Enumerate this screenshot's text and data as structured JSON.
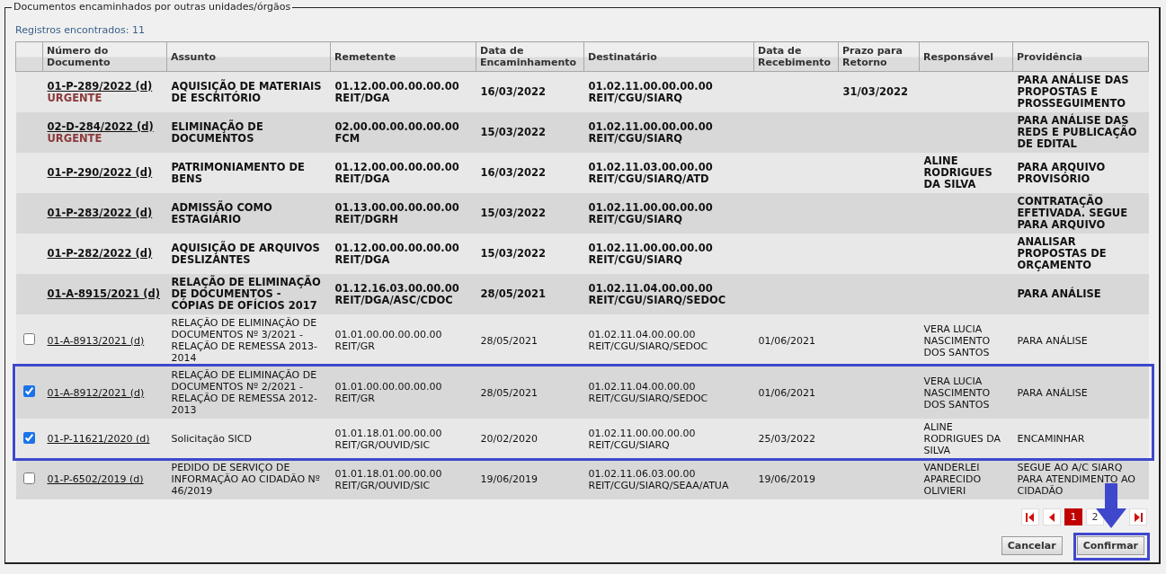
{
  "fieldset": {
    "legend": "Documentos encaminhados por outras unidades/órgãos",
    "count_label": "Registros encontrados: 11"
  },
  "table": {
    "columns": [
      "Número do Documento",
      "Assunto",
      "Remetente",
      "Data de Encaminhamento",
      "Destinatário",
      "Data de Recebimento",
      "Prazo para Retorno",
      "Responsável",
      "Providência"
    ],
    "rows": [
      {
        "kind": "pending",
        "highlighted": false,
        "urgent": "URGENTE",
        "cells": [
          "01-P-289/2022 (d)",
          "AQUISIÇÃO DE MATERIAIS DE ESCRITÓRIO",
          "01.12.00.00.00.00.00 REIT/DGA",
          "16/03/2022",
          "01.02.11.00.00.00.00 REIT/CGU/SIARQ",
          "",
          "31/03/2022",
          "",
          "PARA ANÁLISE DAS PROPOSTAS E PROSSEGUIMENTO"
        ]
      },
      {
        "kind": "pending",
        "highlighted": false,
        "urgent": "URGENTE",
        "cells": [
          "02-D-284/2022 (d)",
          "ELIMINAÇÃO DE DOCUMENTOS",
          "02.00.00.00.00.00.00 FCM",
          "15/03/2022",
          "01.02.11.00.00.00.00 REIT/CGU/SIARQ",
          "",
          "",
          "",
          "PARA ANÁLISE DAS REDS E PUBLICAÇÃO DE EDITAL"
        ]
      },
      {
        "kind": "pending",
        "highlighted": false,
        "cells": [
          "01-P-290/2022 (d)",
          "PATRIMONIAMENTO DE BENS",
          "01.12.00.00.00.00.00 REIT/DGA",
          "16/03/2022",
          "01.02.11.03.00.00.00 REIT/CGU/SIARQ/ATD",
          "",
          "",
          "ALINE RODRIGUES DA SILVA",
          "PARA ARQUIVO PROVISÓRIO"
        ]
      },
      {
        "kind": "pending",
        "highlighted": false,
        "cells": [
          "01-P-283/2022 (d)",
          "ADMISSÃO COMO ESTAGIÁRIO",
          "01.13.00.00.00.00.00 REIT/DGRH",
          "15/03/2022",
          "01.02.11.00.00.00.00 REIT/CGU/SIARQ",
          "",
          "",
          "",
          "CONTRATAÇÃO EFETIVADA. SEGUE PARA ARQUIVO"
        ]
      },
      {
        "kind": "pending",
        "highlighted": false,
        "cells": [
          "01-P-282/2022 (d)",
          "AQUISIÇÃO DE ARQUIVOS DESLIZANTES",
          "01.12.00.00.00.00.00 REIT/DGA",
          "15/03/2022",
          "01.02.11.00.00.00.00 REIT/CGU/SIARQ",
          "",
          "",
          "",
          "ANALISAR PROPOSTAS DE ORÇAMENTO"
        ]
      },
      {
        "kind": "pending",
        "highlighted": false,
        "cells": [
          "01-A-8915/2021 (d)",
          "RELAÇÃO DE ELIMINAÇÃO DE DOCUMENTOS - CÓPIAS DE OFÍCIOS 2017",
          "01.12.16.03.00.00.00 REIT/DGA/ASC/CDOC",
          "28/05/2021",
          "01.02.11.04.00.00.00 REIT/CGU/SIARQ/SEDOC",
          "",
          "",
          "",
          "PARA ANÁLISE"
        ]
      },
      {
        "kind": "received",
        "checked": false,
        "highlighted": false,
        "cells": [
          "01-A-8913/2021 (d)",
          "RELAÇÃO DE ELIMINAÇÃO DE DOCUMENTOS Nº 3/2021 - RELAÇÃO DE REMESSA 2013-2014",
          "01.01.00.00.00.00.00 REIT/GR",
          "28/05/2021",
          "01.02.11.04.00.00.00 REIT/CGU/SIARQ/SEDOC",
          "01/06/2021",
          "",
          "VERA LUCIA NASCIMENTO DOS SANTOS",
          "PARA ANÁLISE"
        ]
      },
      {
        "kind": "received",
        "checked": true,
        "highlighted": true,
        "cells": [
          "01-A-8912/2021 (d)",
          "RELAÇÃO DE ELIMINAÇÃO DE DOCUMENTOS Nº 2/2021 - RELAÇÃO DE REMESSA 2012-2013",
          "01.01.00.00.00.00.00 REIT/GR",
          "28/05/2021",
          "01.02.11.04.00.00.00 REIT/CGU/SIARQ/SEDOC",
          "01/06/2021",
          "",
          "VERA LUCIA NASCIMENTO DOS SANTOS",
          "PARA ANÁLISE"
        ]
      },
      {
        "kind": "received",
        "checked": true,
        "highlighted": true,
        "cells": [
          "01-P-11621/2020 (d)",
          "Solicitação SICD",
          "01.01.18.01.00.00.00 REIT/GR/OUVID/SIC",
          "20/02/2020",
          "01.02.11.00.00.00.00 REIT/CGU/SIARQ",
          "25/03/2022",
          "",
          "ALINE RODRIGUES DA SILVA",
          "ENCAMINHAR"
        ]
      },
      {
        "kind": "received",
        "checked": false,
        "highlighted": false,
        "cells": [
          "01-P-6502/2019 (d)",
          "PEDIDO DE SERVIÇO DE INFORMAÇÃO AO CIDADÃO Nº 46/2019",
          "01.01.18.01.00.00.00 REIT/GR/OUVID/SIC",
          "19/06/2019",
          "01.02.11.06.03.00.00 REIT/CGU/SIARQ/SEAA/ATUA",
          "19/06/2019",
          "",
          "VANDERLEI APARECIDO OLIVIERI",
          "SEGUE AO A/C SIARQ PARA ATENDIMENTO AO CIDADÃO"
        ]
      }
    ]
  },
  "pager": [
    {
      "kind": "first"
    },
    {
      "kind": "prev"
    },
    {
      "kind": "page",
      "label": "1",
      "selected": true
    },
    {
      "kind": "page",
      "label": "2",
      "selected": false
    },
    {
      "kind": "last"
    }
  ],
  "buttons": [
    {
      "label": "Cancelar",
      "highlighted": false
    },
    {
      "label": "Confirmar",
      "highlighted": true
    }
  ]
}
